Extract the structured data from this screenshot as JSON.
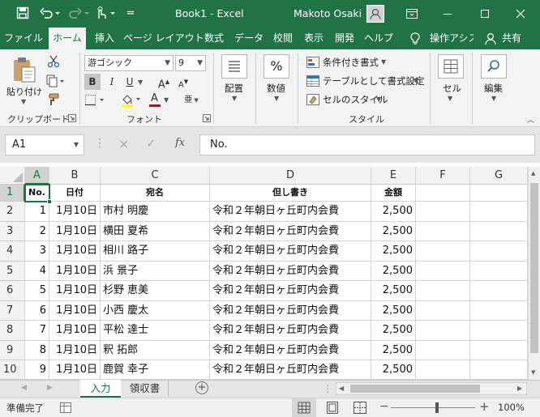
{
  "colors": {
    "accent": "#217346",
    "selection": "#217346"
  },
  "titlebar": {
    "title": "Book1  -  Excel",
    "user": "Makoto Osaki",
    "qat_more": "="
  },
  "tabs": [
    {
      "label": "ファイル"
    },
    {
      "label": "ホーム"
    },
    {
      "label": "挿入"
    },
    {
      "label": "ページ レイアウト"
    },
    {
      "label": "数式"
    },
    {
      "label": "データ"
    },
    {
      "label": "校閲"
    },
    {
      "label": "表示"
    },
    {
      "label": "開発"
    },
    {
      "label": "ヘルプ"
    },
    {
      "label": "操作アシス"
    },
    {
      "label": "共有"
    }
  ],
  "ribbon": {
    "clipboard": {
      "paste": "貼り付け",
      "group": "クリップボード"
    },
    "font": {
      "name": "游ゴシック",
      "size": "9",
      "bold": "B",
      "italic": "I",
      "underline": "U",
      "grow": "A",
      "shrink": "A",
      "color_a": "A",
      "phonetic": "亜",
      "group": "フォント"
    },
    "alignment": {
      "label": "配置",
      "icon": "≡"
    },
    "number": {
      "label": "数値",
      "icon": "%"
    },
    "styles": {
      "conditional": "条件付き書式",
      "table": "テーブルとして書式設定",
      "cell_style": "セルのスタイル",
      "group": "スタイル"
    },
    "cells": {
      "label": "セル"
    },
    "editing": {
      "label": "編集"
    }
  },
  "formula": {
    "name_box": "A1",
    "cancel": "×",
    "enter": "✓",
    "fx": "fx",
    "value": "No."
  },
  "grid": {
    "columns": [
      "A",
      "B",
      "C",
      "D",
      "E",
      "F",
      "G"
    ],
    "rows": [
      "1",
      "2",
      "3",
      "4",
      "5",
      "6",
      "7",
      "8",
      "9",
      "10"
    ],
    "header": {
      "no": "No.",
      "date": "日付",
      "name": "宛名",
      "purpose": "但し書き",
      "amount": "金額"
    },
    "records": [
      {
        "no": "1",
        "date": "1月10日",
        "name": "市村 明慶",
        "purpose": "令和２年朝日ヶ丘町内会費",
        "amount": "2,500"
      },
      {
        "no": "2",
        "date": "1月10日",
        "name": "横田 夏希",
        "purpose": "令和２年朝日ヶ丘町内会費",
        "amount": "2,500"
      },
      {
        "no": "3",
        "date": "1月10日",
        "name": "相川 路子",
        "purpose": "令和２年朝日ヶ丘町内会費",
        "amount": "2,500"
      },
      {
        "no": "4",
        "date": "1月10日",
        "name": "浜 景子",
        "purpose": "令和２年朝日ヶ丘町内会費",
        "amount": "2,500"
      },
      {
        "no": "5",
        "date": "1月10日",
        "name": "杉野 恵美",
        "purpose": "令和２年朝日ヶ丘町内会費",
        "amount": "2,500"
      },
      {
        "no": "6",
        "date": "1月10日",
        "name": "小西 慶太",
        "purpose": "令和２年朝日ヶ丘町内会費",
        "amount": "2,500"
      },
      {
        "no": "7",
        "date": "1月10日",
        "name": "平松 達士",
        "purpose": "令和２年朝日ヶ丘町内会費",
        "amount": "2,500"
      },
      {
        "no": "8",
        "date": "1月10日",
        "name": "釈 拓郎",
        "purpose": "令和２年朝日ヶ丘町内会費",
        "amount": "2,500"
      },
      {
        "no": "9",
        "date": "1月10日",
        "name": "鹿賀 幸子",
        "purpose": "令和２年朝日ヶ丘町内会費",
        "amount": "2,500"
      }
    ]
  },
  "sheets": [
    {
      "label": "入力",
      "active": true
    },
    {
      "label": "領収書",
      "active": false
    }
  ],
  "add_sheet": "+",
  "status": {
    "ready": "準備完了",
    "zoom": "100%",
    "zoom_in": "+",
    "zoom_out": "−"
  }
}
